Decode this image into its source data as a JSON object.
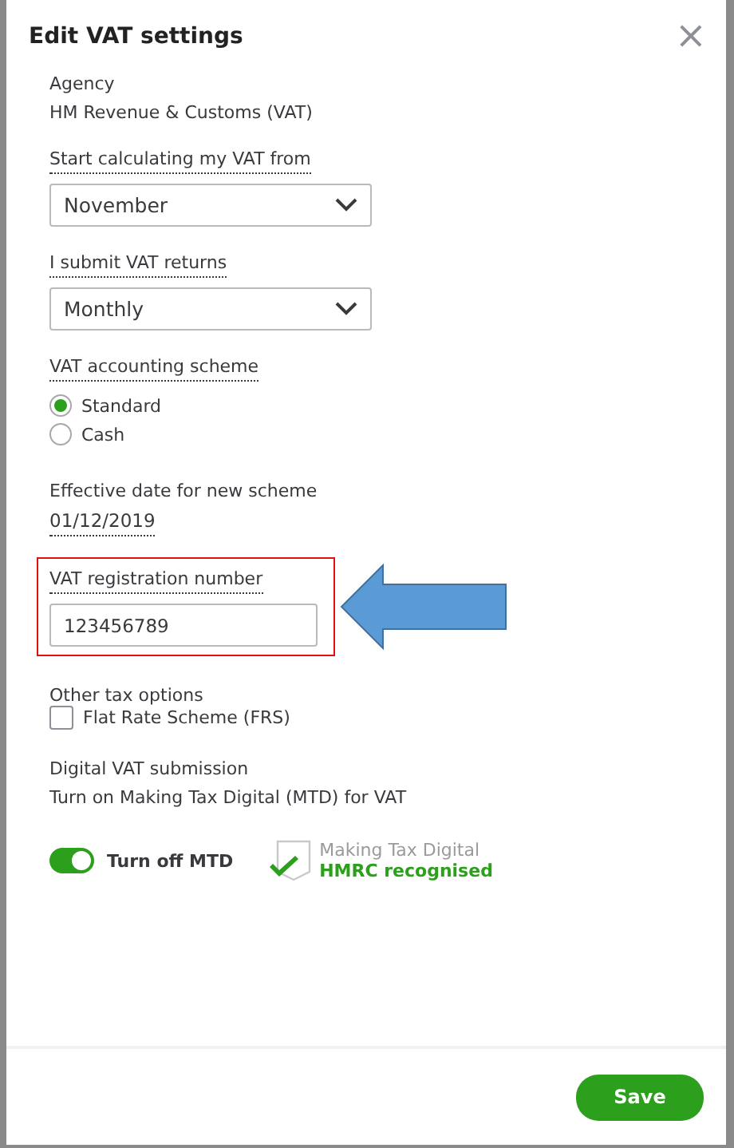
{
  "dialog": {
    "title": "Edit VAT settings",
    "close": "×"
  },
  "agency": {
    "label": "Agency",
    "value": "HM Revenue & Customs (VAT)"
  },
  "start": {
    "label": "Start calculating my VAT from",
    "value": "November"
  },
  "returns": {
    "label": "I submit VAT returns",
    "value": "Monthly"
  },
  "scheme": {
    "label": "VAT accounting scheme",
    "options": [
      {
        "label": "Standard",
        "selected": true
      },
      {
        "label": "Cash",
        "selected": false
      }
    ]
  },
  "effective": {
    "label": "Effective date for new scheme",
    "value": "01/12/2019"
  },
  "vat_registration": {
    "label": "VAT registration number",
    "value": "123456789",
    "highlighted": true
  },
  "other_tax": {
    "label": "Other tax options",
    "options": [
      {
        "label": "Flat Rate Scheme (FRS)",
        "checked": false
      }
    ]
  },
  "digital": {
    "label": "Digital VAT submission",
    "description": "Turn on Making Tax Digital (MTD) for VAT",
    "toggle": {
      "label": "Turn off MTD",
      "on": true
    },
    "badge": {
      "line_1": "Making Tax Digital",
      "line_2": "HMRC recognised"
    }
  },
  "footer": {
    "save": "Save"
  }
}
